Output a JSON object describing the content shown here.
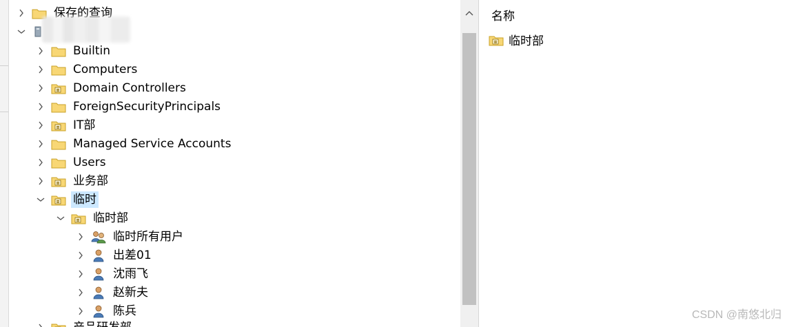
{
  "tree": {
    "saved_queries": "保存的查询",
    "domain_name": "",
    "nodes": [
      {
        "label": "Builtin",
        "icon": "folder-icon"
      },
      {
        "label": "Computers",
        "icon": "folder-icon"
      },
      {
        "label": "Domain Controllers",
        "icon": "ou-folder-icon"
      },
      {
        "label": "ForeignSecurityPrincipals",
        "icon": "folder-icon"
      },
      {
        "label": "IT部",
        "icon": "ou-folder-icon"
      },
      {
        "label": "Managed Service Accounts",
        "icon": "folder-icon"
      },
      {
        "label": "Users",
        "icon": "folder-icon"
      },
      {
        "label": "业务部",
        "icon": "ou-folder-icon"
      },
      {
        "label": "临时",
        "icon": "ou-folder-icon"
      },
      {
        "label": "临时部",
        "icon": "ou-folder-icon"
      },
      {
        "label": "临时所有用户",
        "icon": "group-icon"
      },
      {
        "label": "出差01",
        "icon": "user-icon"
      },
      {
        "label": "沈雨飞",
        "icon": "user-icon"
      },
      {
        "label": "赵新夫",
        "icon": "user-icon"
      },
      {
        "label": "陈兵",
        "icon": "user-icon"
      },
      {
        "label": "产品研发部",
        "icon": "ou-folder-icon"
      }
    ]
  },
  "list": {
    "column_name": "名称",
    "items": [
      {
        "label": "临时部",
        "icon": "ou-folder-icon"
      }
    ]
  },
  "watermark": "CSDN @南悠北归",
  "colors": {
    "selection": "#cce8ff",
    "folder_fill": "#f8d775",
    "folder_border": "#c9a227"
  }
}
